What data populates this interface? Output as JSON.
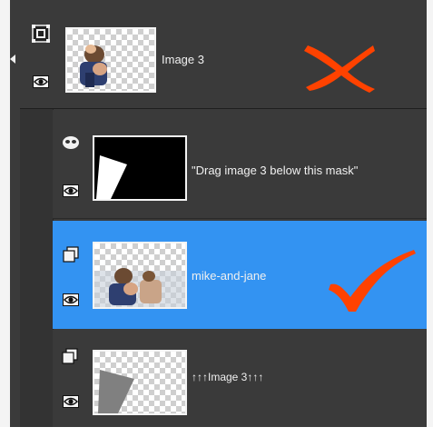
{
  "panel": {
    "background": "#3a3a3a",
    "selected_color": "#3393f2",
    "mark_color": "#ff4200"
  },
  "layers": [
    {
      "name": "Image 3",
      "type_icon": "clipping-group-icon",
      "visibility_icon": "eye-icon",
      "thumbnail": "photo-thumbnail",
      "annotation": "red-x-mark"
    },
    {
      "name": "\"Drag image 3 below this mask\"",
      "type_icon": "mask-icon",
      "visibility_icon": "eye-icon",
      "thumbnail": "mask-thumbnail"
    },
    {
      "name": "mike-and-jane",
      "type_icon": "layer-icon",
      "visibility_icon": "eye-icon",
      "thumbnail": "photo-thumbnail",
      "selected": true,
      "annotation": "red-check-mark"
    },
    {
      "name": "↑↑↑Image 3↑↑↑",
      "type_icon": "layer-icon",
      "visibility_icon": "eye-icon",
      "thumbnail": "shape-thumbnail"
    }
  ]
}
